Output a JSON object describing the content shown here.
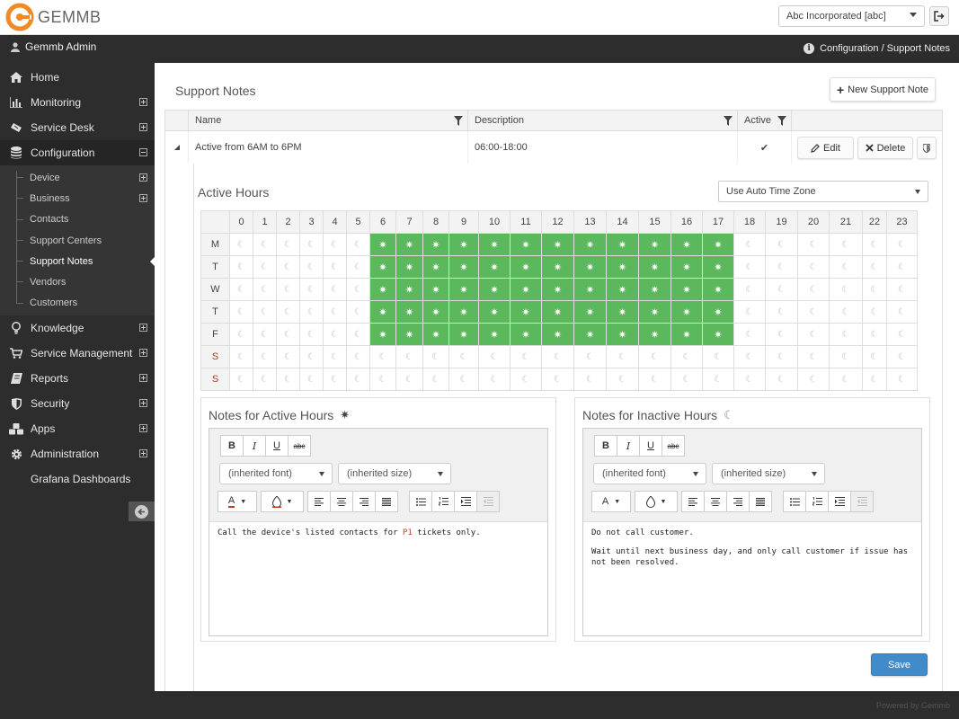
{
  "app": {
    "brand": "GEMMB",
    "company": "Abc Incorporated [abc]",
    "user": "Gemmb Admin",
    "breadcrumb": "Configuration / Support Notes",
    "footer": "Powered by Gemmb"
  },
  "colors": {
    "accent_orange": "#f08a24",
    "active_green": "#5cb85c",
    "primary_blue": "#428bca",
    "sidebar_bg": "#2d2d2d"
  },
  "sidebar": {
    "items_top": [
      {
        "label": "Home",
        "icon": "home-icon"
      },
      {
        "label": "Monitoring",
        "icon": "bar-chart-icon"
      },
      {
        "label": "Service Desk",
        "icon": "ticket-icon"
      },
      {
        "label": "Configuration",
        "icon": "database-icon"
      }
    ],
    "sub_items": [
      {
        "label": "Device"
      },
      {
        "label": "Business"
      },
      {
        "label": "Contacts"
      },
      {
        "label": "Support Centers"
      },
      {
        "label": "Support Notes"
      },
      {
        "label": "Vendors"
      },
      {
        "label": "Customers"
      }
    ],
    "items_bottom": [
      {
        "label": "Knowledge",
        "icon": "lightbulb-icon"
      },
      {
        "label": "Service Management",
        "icon": "cart-icon"
      },
      {
        "label": "Reports",
        "icon": "book-icon"
      },
      {
        "label": "Security",
        "icon": "shield-icon"
      },
      {
        "label": "Apps",
        "icon": "cubes-icon"
      },
      {
        "label": "Administration",
        "icon": "gear-icon"
      }
    ],
    "grafana": "Grafana Dashboards"
  },
  "main": {
    "title": "Support Notes",
    "new_button": "New Support Note",
    "columns": {
      "name": "Name",
      "description": "Description",
      "active": "Active"
    },
    "row": {
      "name": "Active from 6AM to 6PM",
      "description": "06:00-18:00",
      "active_mark": "✔",
      "edit": "Edit",
      "delete": "Delete"
    },
    "active_hours": {
      "title": "Active Hours",
      "timezone": "Use Auto Time Zone",
      "hours": [
        "0",
        "1",
        "2",
        "3",
        "4",
        "5",
        "6",
        "7",
        "8",
        "9",
        "10",
        "11",
        "12",
        "13",
        "14",
        "15",
        "16",
        "17",
        "18",
        "19",
        "20",
        "21",
        "22",
        "23"
      ],
      "days": [
        {
          "label": "M",
          "weekend": false,
          "active": [
            6,
            7,
            8,
            9,
            10,
            11,
            12,
            13,
            14,
            15,
            16,
            17
          ]
        },
        {
          "label": "T",
          "weekend": false,
          "active": [
            6,
            7,
            8,
            9,
            10,
            11,
            12,
            13,
            14,
            15,
            16,
            17
          ]
        },
        {
          "label": "W",
          "weekend": false,
          "active": [
            6,
            7,
            8,
            9,
            10,
            11,
            12,
            13,
            14,
            15,
            16,
            17
          ]
        },
        {
          "label": "T",
          "weekend": false,
          "active": [
            6,
            7,
            8,
            9,
            10,
            11,
            12,
            13,
            14,
            15,
            16,
            17
          ]
        },
        {
          "label": "F",
          "weekend": false,
          "active": [
            6,
            7,
            8,
            9,
            10,
            11,
            12,
            13,
            14,
            15,
            16,
            17
          ]
        },
        {
          "label": "S",
          "weekend": true,
          "active": []
        },
        {
          "label": "S",
          "weekend": true,
          "active": []
        }
      ],
      "sun_glyph": "✷",
      "moon_glyph": "☾"
    },
    "editor": {
      "bold": "B",
      "italic": "I",
      "underline": "U",
      "strike": "abc",
      "font": "(inherited font)",
      "size": "(inherited size)"
    },
    "notes_active": {
      "title": "Notes for Active Hours",
      "text_before": "Call the device's listed contacts for ",
      "text_highlight": "P1",
      "text_after": " tickets only."
    },
    "notes_inactive": {
      "title": "Notes for Inactive Hours",
      "line1": "Do not call customer.",
      "line2": "Wait until next business day, and only call customer if issue has not been resolved."
    },
    "save": "Save"
  }
}
